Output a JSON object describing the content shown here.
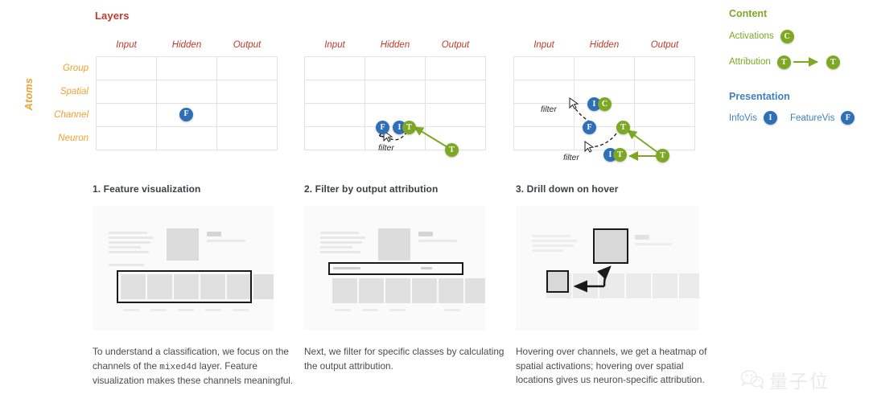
{
  "top": {
    "layers_title": "Layers",
    "atoms_title": "Atoms",
    "columns": [
      "Input",
      "Hidden",
      "Output"
    ],
    "rows": [
      "Group",
      "Spatial",
      "Channel",
      "Neuron"
    ],
    "filter_label": "filter",
    "grids": [
      {
        "name": "grid-feature-visualization",
        "badges": [
          {
            "letter": "F",
            "color": "blue",
            "row": "Channel",
            "col": "Hidden"
          }
        ]
      },
      {
        "name": "grid-filter-by-output-attribution",
        "badges": [
          {
            "letter": "F",
            "color": "blue",
            "row": "Channel",
            "col": "Hidden"
          },
          {
            "letter": "I",
            "color": "blue",
            "row": "Channel",
            "col": "Hidden"
          },
          {
            "letter": "T",
            "color": "olive",
            "row": "Channel",
            "col": "Hidden"
          },
          {
            "letter": "T",
            "color": "olive",
            "row": "Neuron",
            "col": "Output"
          }
        ],
        "filter_labels": [
          "filter"
        ]
      },
      {
        "name": "grid-drill-down-on-hover",
        "badges": [
          {
            "letter": "I",
            "color": "blue",
            "row": "Spatial",
            "col": "Hidden"
          },
          {
            "letter": "C",
            "color": "olive",
            "row": "Spatial",
            "col": "Hidden"
          },
          {
            "letter": "F",
            "color": "blue",
            "row": "Channel",
            "col": "Hidden"
          },
          {
            "letter": "T",
            "color": "olive",
            "row": "Channel",
            "col": "Hidden"
          },
          {
            "letter": "I",
            "color": "blue",
            "row": "Neuron",
            "col": "Hidden"
          },
          {
            "letter": "T",
            "color": "olive",
            "row": "Neuron",
            "col": "Hidden"
          },
          {
            "letter": "T",
            "color": "olive",
            "row": "Neuron",
            "col": "Output"
          }
        ],
        "filter_labels": [
          "filter",
          "filter"
        ]
      }
    ]
  },
  "legend": {
    "content_heading": "Content",
    "activations_label": "Activations",
    "activations_badge": "C",
    "attribution_label": "Attribution",
    "attribution_badge_from": "T",
    "attribution_badge_to": "T",
    "presentation_heading": "Presentation",
    "infovis_label": "InfoVis",
    "infovis_badge": "I",
    "featurevis_label": "FeatureVis",
    "featurevis_badge": "F"
  },
  "colors": {
    "content": "#7da823",
    "presentation": "#3f7fc1",
    "badge_blue": "#2f6fb8",
    "badge_olive": "#7da823",
    "layers_red": "#c0392b",
    "atoms_orange": "#f0a030"
  },
  "panels": [
    {
      "title": "1. Feature visualization",
      "caption_pre": "To understand a classification, we focus on the channels of the ",
      "caption_mono": "mixed4d",
      "caption_post": " layer. Feature visualization makes these channels meaningful."
    },
    {
      "title": "2. Filter by output attribution",
      "caption_pre": "Next, we filter for specific classes by calculating the output attribution.",
      "caption_mono": "",
      "caption_post": ""
    },
    {
      "title": "3. Drill down on hover",
      "caption_pre": "Hovering over channels, we get a heatmap of spatial activations; hovering over spatial locations gives us neuron-specific attribution.",
      "caption_mono": "",
      "caption_post": ""
    }
  ],
  "watermark": {
    "text": "量子位"
  }
}
